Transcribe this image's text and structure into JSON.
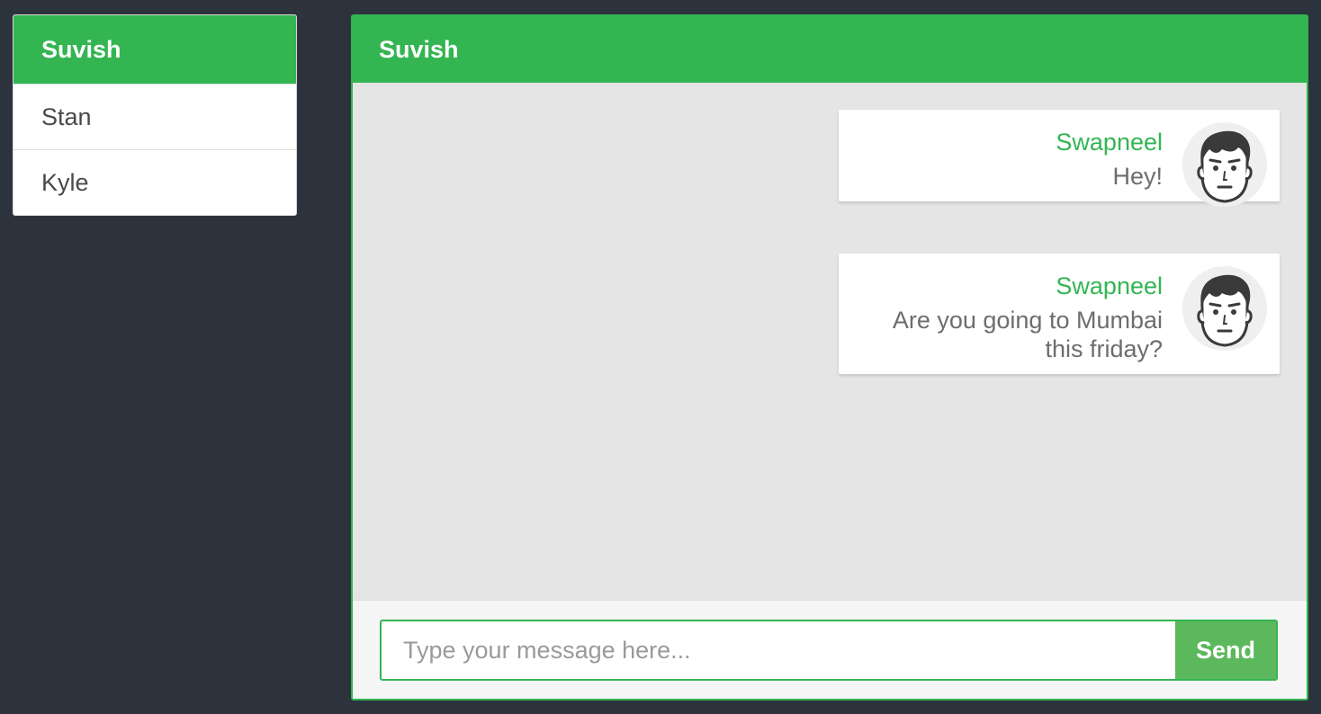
{
  "sidebar": {
    "title": "Suvish",
    "contacts": [
      {
        "name": "Stan"
      },
      {
        "name": "Kyle"
      }
    ]
  },
  "chat": {
    "title": "Suvish",
    "messages": [
      {
        "author": "Swapneel",
        "text": "Hey!",
        "avatar": "avatar-face-icon"
      },
      {
        "author": "Swapneel",
        "text": "Are you going to Mumbai this friday?",
        "avatar": "avatar-face-icon"
      }
    ],
    "composer": {
      "placeholder": "Type your message here...",
      "value": "",
      "send_label": "Send"
    }
  },
  "colors": {
    "background": "#2c333c",
    "accent": "#33b552",
    "send_button": "#5cb85c",
    "chat_area": "#e5e5e5"
  }
}
